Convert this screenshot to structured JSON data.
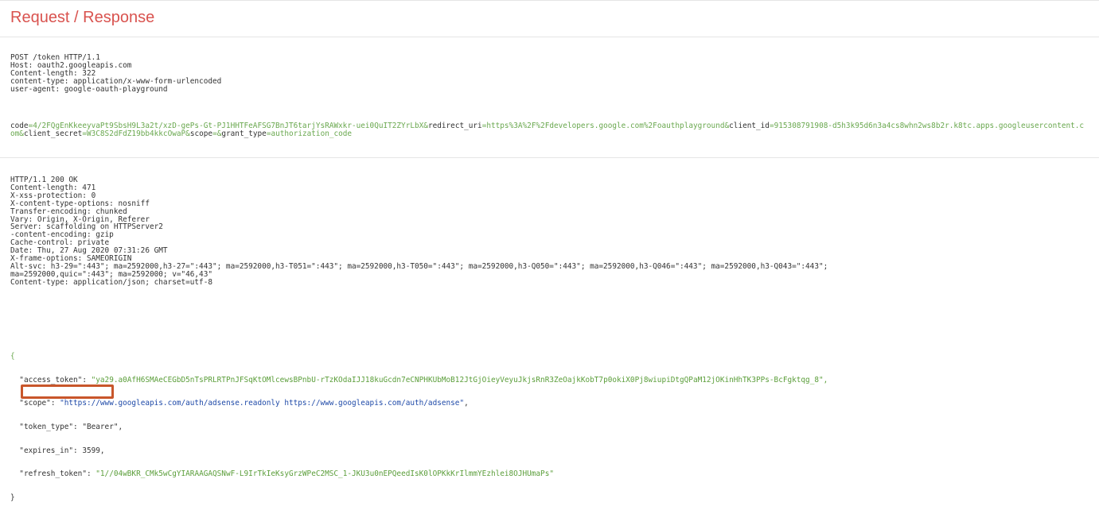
{
  "title": "Request / Response",
  "request": {
    "headers": [
      "POST /token HTTP/1.1",
      "Host: oauth2.googleapis.com",
      "Content-length: 322",
      "content-type: application/x-www-form-urlencoded",
      "user-agent: google-oauth-playground"
    ],
    "body": [
      {
        "k": "code",
        "v": "4/2FQgEnKkeeyvaPt9SbsH9L3a2t/xzD-gePs-Gt-PJ1HHTFeAFSG7BnJT6tarjYsRAWxkr-uei0QuIT2ZYrLbX"
      },
      {
        "k": "redirect_uri",
        "v": "https%3A%2F%2Fdevelopers.google.com%2Foauthplayground"
      },
      {
        "k": "client_id",
        "v": "915308791908-d5h3k95d6n3a4cs8whn2ws8b2r.k8tc.apps.googleusercontent.com"
      },
      {
        "k": "client_secret",
        "v": "W3C8S2dFdZ19bb4kkcOwaP"
      },
      {
        "k": "scope",
        "v": ""
      },
      {
        "k": "grant_type",
        "v": "authorization_code"
      }
    ]
  },
  "response": {
    "headers": [
      "HTTP/1.1 200 OK",
      "Content-length: 471",
      "X-xss-protection: 0",
      "X-content-type-options: nosniff",
      "Transfer-encoding: chunked",
      "Vary: Origin, X-Origin, Referer",
      "Server: scaffolding on HTTPServer2",
      "-content-encoding: gzip",
      "Cache-control: private",
      "Date: Thu, 27 Aug 2020 07:31:26 GMT",
      "X-frame-options: SAMEORIGIN",
      "Alt-svc: h3-29=\":443\"; ma=2592000,h3-27=\":443\"; ma=2592000,h3-T051=\":443\"; ma=2592000,h3-T050=\":443\"; ma=2592000,h3-Q050=\":443\"; ma=2592000,h3-Q046=\":443\"; ma=2592000,h3-Q043=\":443\";",
      "ma=2592000,quic=\":443\"; ma=2592000; v=\"46,43\"",
      "Content-type: application/json; charset=utf-8"
    ],
    "json": {
      "open": "{",
      "close": "}",
      "access_token_key": "\"access_token\"",
      "access_token_val": "\"ya29.a0AfH6SMAeCEGbD5nTsPRLRTPnJFSqKtOMlcewsBPnbU-rTzKOdaIJJ18kuGcdn7eCNPHKUbMoB12JtGjOieyVeyuJkjsRnR3ZeOajkKobT7p0okiX0Pj8wiupiDtgQPaM12jOKinHhTK3PPs-BcFgktqg_8\",",
      "scope_key": "\"scope\"",
      "scope_val": "\"https://www.googleapis.com/auth/adsense.readonly https://www.googleapis.com/auth/adsense\"",
      "token_type_key": "\"token_type\"",
      "token_type_val": "\"Bearer\"",
      "expires_in_key": "\"expires_in\"",
      "expires_in_val": "3599",
      "refresh_token_key": "\"refresh_token\"",
      "refresh_token_val": "\"1//04wBKR_CMk5wCgYIARAAGAQSNwF-L9IrTkIeKsyGrzWPeC2MSC_1-JKU3u0nEPQeedIsK0lOPKkKrIlmmYEzhlei8OJHUmaPs\""
    }
  },
  "colors": {
    "title": "#d9534f",
    "string": "#5b9e3a",
    "url": "#1f4aa8",
    "highlight": "#c8562b"
  }
}
